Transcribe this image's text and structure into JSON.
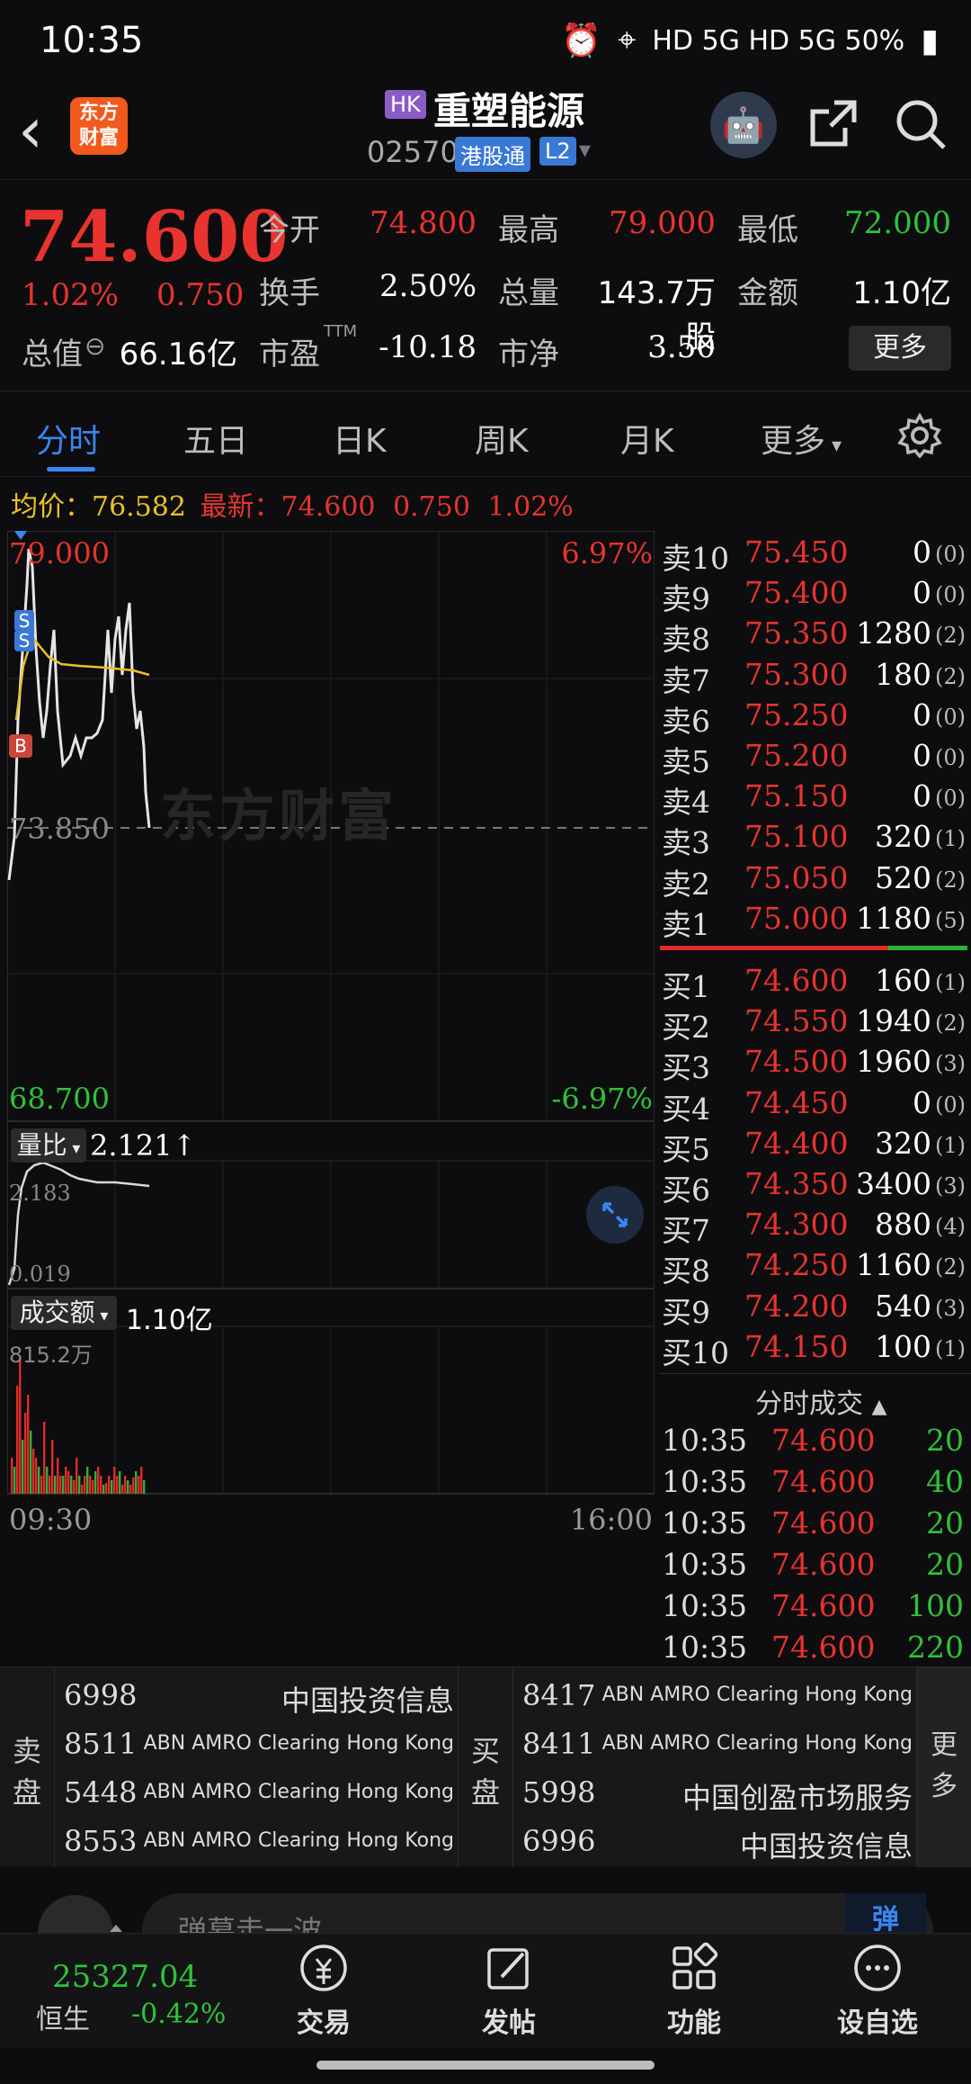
{
  "status_bar": {
    "time": "10:35",
    "right": "HD  5G  HD  5G  50%"
  },
  "header": {
    "logo": "东方\n财富",
    "market_badge": "HK",
    "stock_name": "重塑能源",
    "stock_code": "02570",
    "tag_ggt": "港股通",
    "tag_l2": "L2"
  },
  "quote": {
    "price": "74.600",
    "change_pct": "1.02%",
    "change": "0.750",
    "open_label": "今开",
    "open": "74.800",
    "high_label": "最高",
    "high": "79.000",
    "low_label": "最低",
    "low": "72.000",
    "turnover_label": "换手",
    "turnover": "2.50%",
    "volume_label": "总量",
    "volume": "143.7万股",
    "amount_label": "金额",
    "amount": "1.10亿",
    "mktcap_label": "总值",
    "mktcap": "66.16亿",
    "pe_label": "市盈",
    "pe_sup": "TTM",
    "pe": "-10.18",
    "pb_label": "市净",
    "pb": "3.50",
    "more": "更多"
  },
  "tabs": [
    "分时",
    "五日",
    "日K",
    "周K",
    "月K",
    "更多"
  ],
  "avg_line": {
    "avg_label": "均价：",
    "avg": "76.582",
    "latest_label": "最新：",
    "latest": "74.600",
    "chg": "0.750",
    "pct": "1.02%"
  },
  "chart": {
    "top_price": "79.000",
    "top_pct": "6.97%",
    "mid_price": "73.850",
    "bottom_price": "68.700",
    "bottom_pct": "-6.97%",
    "watermark": "东方财富",
    "vol_ratio_label": "量比",
    "vol_ratio": "2.121↑",
    "vr_top": "2.183",
    "vr_bottom": "0.019",
    "amount_label": "成交额",
    "amount": "1.10亿",
    "amt_top": "815.2万",
    "time_start": "09:30",
    "time_end": "16:00",
    "marker_s": "S",
    "marker_b": "B",
    "accent": "#3a86f0"
  },
  "asks": [
    {
      "label": "卖10",
      "price": "75.450",
      "vol": "0",
      "n": "(0)"
    },
    {
      "label": "卖9",
      "price": "75.400",
      "vol": "0",
      "n": "(0)"
    },
    {
      "label": "卖8",
      "price": "75.350",
      "vol": "1280",
      "n": "(2)"
    },
    {
      "label": "卖7",
      "price": "75.300",
      "vol": "180",
      "n": "(2)"
    },
    {
      "label": "卖6",
      "price": "75.250",
      "vol": "0",
      "n": "(0)"
    },
    {
      "label": "卖5",
      "price": "75.200",
      "vol": "0",
      "n": "(0)"
    },
    {
      "label": "卖4",
      "price": "75.150",
      "vol": "0",
      "n": "(0)"
    },
    {
      "label": "卖3",
      "price": "75.100",
      "vol": "320",
      "n": "(1)"
    },
    {
      "label": "卖2",
      "price": "75.050",
      "vol": "520",
      "n": "(2)"
    },
    {
      "label": "卖1",
      "price": "75.000",
      "vol": "1180",
      "n": "(5)"
    }
  ],
  "bids": [
    {
      "label": "买1",
      "price": "74.600",
      "vol": "160",
      "n": "(1)"
    },
    {
      "label": "买2",
      "price": "74.550",
      "vol": "1940",
      "n": "(2)"
    },
    {
      "label": "买3",
      "price": "74.500",
      "vol": "1960",
      "n": "(3)"
    },
    {
      "label": "买4",
      "price": "74.450",
      "vol": "0",
      "n": "(0)"
    },
    {
      "label": "买5",
      "price": "74.400",
      "vol": "320",
      "n": "(1)"
    },
    {
      "label": "买6",
      "price": "74.350",
      "vol": "3400",
      "n": "(3)"
    },
    {
      "label": "买7",
      "price": "74.300",
      "vol": "880",
      "n": "(4)"
    },
    {
      "label": "买8",
      "price": "74.250",
      "vol": "1160",
      "n": "(2)"
    },
    {
      "label": "买9",
      "price": "74.200",
      "vol": "540",
      "n": "(3)"
    },
    {
      "label": "买10",
      "price": "74.150",
      "vol": "100",
      "n": "(1)"
    }
  ],
  "trades_header": "分时成交",
  "trades": [
    {
      "time": "10:35",
      "price": "74.600",
      "vol": "20"
    },
    {
      "time": "10:35",
      "price": "74.600",
      "vol": "40"
    },
    {
      "time": "10:35",
      "price": "74.600",
      "vol": "20"
    },
    {
      "time": "10:35",
      "price": "74.600",
      "vol": "20"
    },
    {
      "time": "10:35",
      "price": "74.600",
      "vol": "100"
    },
    {
      "time": "10:35",
      "price": "74.600",
      "vol": "220"
    }
  ],
  "broker": {
    "sell_label": "卖\n盘",
    "buy_label": "买\n盘",
    "more_label": "更\n多",
    "sell": [
      {
        "code": "6998",
        "name": "中国投资信息"
      },
      {
        "code": "8511",
        "name": "ABN AMRO Clearing Hong Kong"
      },
      {
        "code": "5448",
        "name": "ABN AMRO Clearing Hong Kong"
      },
      {
        "code": "8553",
        "name": "ABN AMRO Clearing Hong Kong"
      }
    ],
    "buy": [
      {
        "code": "8417",
        "name": "ABN AMRO Clearing Hong Kong"
      },
      {
        "code": "8411",
        "name": "ABN AMRO Clearing Hong Kong"
      },
      {
        "code": "5998",
        "name": "中国创盈市场服务"
      },
      {
        "code": "6996",
        "name": "中国投资信息"
      }
    ]
  },
  "comment": {
    "placeholder": "弹幕走一波"
  },
  "bottom_nav": {
    "index_value": "25327.04",
    "index_name": "恒生",
    "index_change": "-0.42%",
    "items": [
      "交易",
      "发帖",
      "功能",
      "设自选"
    ]
  }
}
